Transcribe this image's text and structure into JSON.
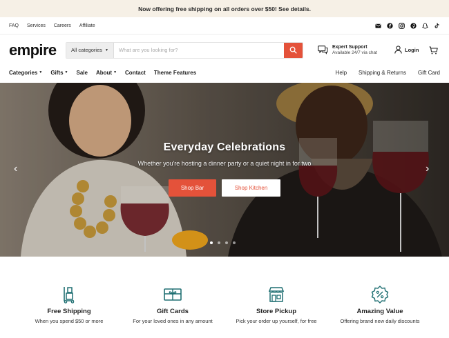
{
  "promo": {
    "text": "Now offering free shipping on all orders over $50! See details."
  },
  "utility": {
    "links": [
      "FAQ",
      "Services",
      "Careers",
      "Affiliate"
    ]
  },
  "header": {
    "logo": "empire",
    "category_select": "All categories",
    "search_placeholder": "What are you looking for?",
    "support_title": "Expert Support",
    "support_sub": "Available 24/7 via chat",
    "login_label": "Login"
  },
  "nav": {
    "left": [
      "Categories",
      "Gifts",
      "Sale",
      "About",
      "Contact",
      "Theme Features"
    ],
    "right": [
      "Help",
      "Shipping & Returns",
      "Gift Card"
    ]
  },
  "hero": {
    "title": "Everyday Celebrations",
    "subtitle": "Whether you're hosting a dinner party or a quiet night in for two",
    "button_primary": "Shop Bar",
    "button_secondary": "Shop Kitchen",
    "slide_count": 4,
    "active_slide": 1
  },
  "features": [
    {
      "title": "Free Shipping",
      "desc": "When you spend $50 or more",
      "icon": "hand-truck-icon"
    },
    {
      "title": "Gift Cards",
      "desc": "For your loved ones in any amount",
      "icon": "gift-icon"
    },
    {
      "title": "Store Pickup",
      "desc": "Pick your order up yourself, for free",
      "icon": "storefront-icon"
    },
    {
      "title": "Amazing Value",
      "desc": "Offering brand new daily discounts",
      "icon": "percent-badge-icon"
    }
  ],
  "colors": {
    "accent": "#e4523a",
    "promo_bg": "#f6f0e6",
    "icon_teal": "#1f6f72"
  }
}
